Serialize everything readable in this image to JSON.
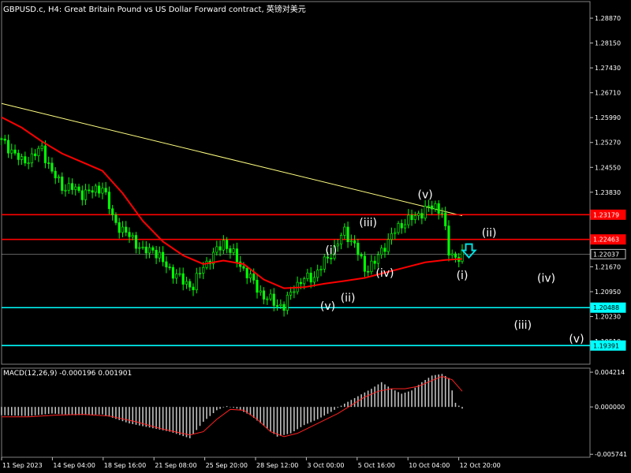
{
  "title": "GBPUSD.c, H4:  Great Britain Pound vs US Dollar Forward contract, 英镑对美元",
  "macd_label": "MACD(12,26,9) -0.000196 0.001901",
  "colors": {
    "background": "#000000",
    "grid": "#2f4f4f",
    "candle": "#00ff00",
    "ma": "#ff0000",
    "trendline": "#ffff80",
    "resistance": "#ff0000",
    "support": "#00ffff",
    "current_price": "#c0c0c0",
    "arrow": "#00e0e0",
    "histogram": "#c0c0c0",
    "signal": "#ff2020",
    "text": "#ffffff"
  },
  "chart_data": [
    {
      "type": "candlestick",
      "symbol": "GBPUSD.c",
      "timeframe": "H4",
      "ylim": [
        1.1885,
        1.2935
      ],
      "y_ticks": [
        "1.28870",
        "1.28150",
        "1.27430",
        "1.26710",
        "1.25990",
        "1.25270",
        "1.24550",
        "1.23830",
        "1.23110",
        "1.22390",
        "1.21670",
        "1.20950",
        "1.20230",
        "1.19510"
      ],
      "x_ticks": [
        "11 Sep 2023",
        "14 Sep 04:00",
        "18 Sep 16:00",
        "21 Sep 08:00",
        "25 Sep 20:00",
        "28 Sep 12:00",
        "3 Oct 00:00",
        "5 Oct 16:00",
        "10 Oct 04:00",
        "12 Oct 20:00"
      ],
      "close_path": [
        [
          0,
          1.253
        ],
        [
          3,
          1.2505
        ],
        [
          6,
          1.247
        ],
        [
          9,
          1.2485
        ],
        [
          12,
          1.251
        ],
        [
          15,
          1.244
        ],
        [
          18,
          1.24
        ],
        [
          21,
          1.2395
        ],
        [
          24,
          1.238
        ],
        [
          27,
          1.2385
        ],
        [
          30,
          1.24
        ],
        [
          33,
          1.231
        ],
        [
          36,
          1.227
        ],
        [
          39,
          1.225
        ],
        [
          42,
          1.221
        ],
        [
          45,
          1.222
        ],
        [
          48,
          1.218
        ],
        [
          51,
          1.215
        ],
        [
          54,
          1.2125
        ],
        [
          57,
          1.211
        ],
        [
          60,
          1.217
        ],
        [
          63,
          1.22
        ],
        [
          66,
          1.224
        ],
        [
          69,
          1.22
        ],
        [
          72,
          1.216
        ],
        [
          75,
          1.212
        ],
        [
          78,
          1.208
        ],
        [
          81,
          1.2065
        ],
        [
          84,
          1.205
        ],
        [
          87,
          1.211
        ],
        [
          90,
          1.213
        ],
        [
          93,
          1.214
        ],
        [
          96,
          1.218
        ],
        [
          99,
          1.222
        ],
        [
          102,
          1.227
        ],
        [
          105,
          1.223
        ],
        [
          108,
          1.216
        ],
        [
          111,
          1.218
        ],
        [
          114,
          1.223
        ],
        [
          117,
          1.227
        ],
        [
          120,
          1.23
        ],
        [
          123,
          1.231
        ],
        [
          126,
          1.2335
        ],
        [
          129,
          1.234
        ],
        [
          131,
          1.233
        ],
        [
          132,
          1.227
        ],
        [
          133,
          1.2205
        ],
        [
          135,
          1.2195
        ],
        [
          137,
          1.2204
        ]
      ],
      "series": [
        {
          "name": "MA",
          "values": [
            [
              0,
              1.26
            ],
            [
              6,
              1.257
            ],
            [
              12,
              1.253
            ],
            [
              18,
              1.2495
            ],
            [
              24,
              1.247
            ],
            [
              30,
              1.2445
            ],
            [
              36,
              1.238
            ],
            [
              42,
              1.23
            ],
            [
              48,
              1.224
            ],
            [
              54,
              1.22
            ],
            [
              60,
              1.2175
            ],
            [
              66,
              1.2185
            ],
            [
              72,
              1.2175
            ],
            [
              78,
              1.213
            ],
            [
              84,
              1.2105
            ],
            [
              90,
              1.2108
            ],
            [
              96,
              1.2118
            ],
            [
              102,
              1.2126
            ],
            [
              108,
              1.2135
            ],
            [
              114,
              1.215
            ],
            [
              120,
              1.2165
            ],
            [
              126,
              1.218
            ],
            [
              132,
              1.2187
            ],
            [
              137,
              1.219
            ]
          ]
        },
        {
          "name": "Trendline",
          "values": [
            [
              0,
              1.264
            ],
            [
              137,
              1.2315
            ]
          ]
        }
      ],
      "horizontal_lines": [
        {
          "price": 1.23179,
          "label": "1.23179",
          "kind": "resistance"
        },
        {
          "price": 1.22463,
          "label": "1.22463",
          "kind": "resistance"
        },
        {
          "price": 1.22037,
          "label": "1.22037",
          "kind": "current"
        },
        {
          "price": 1.20488,
          "label": "1.20488",
          "kind": "support"
        },
        {
          "price": 1.19391,
          "label": "1.19391",
          "kind": "support"
        }
      ],
      "wave_labels": [
        {
          "text": "(v)",
          "x": 126,
          "price": 1.2366
        },
        {
          "text": "(iii)",
          "x": 109,
          "price": 1.2285
        },
        {
          "text": "(i)",
          "x": 98,
          "price": 1.2205
        },
        {
          "text": "(iv)",
          "x": 114,
          "price": 1.2138
        },
        {
          "text": "(ii)",
          "x": 103,
          "price": 1.2067
        },
        {
          "text": "(v)",
          "x": 97,
          "price": 1.2042
        },
        {
          "text": "(ii)",
          "x": 145,
          "price": 1.2255
        },
        {
          "text": "(i)",
          "x": 137,
          "price": 1.2132
        },
        {
          "text": "(iv)",
          "x": 162,
          "price": 1.2124
        },
        {
          "text": "(iii)",
          "x": 155,
          "price": 1.1988
        },
        {
          "text": "(v)",
          "x": 171,
          "price": 1.1948
        }
      ],
      "arrow": {
        "direction": "down",
        "x": 139,
        "price": 1.221
      }
    },
    {
      "type": "bar",
      "name": "MACD(12,26,9)",
      "ylim": [
        -0.0061,
        0.0047
      ],
      "y_ticks": [
        "0.004214",
        "0.000000",
        "-0.005741"
      ],
      "histogram_path": [
        [
          0,
          -0.001
        ],
        [
          8,
          -0.0011
        ],
        [
          15,
          -0.0008
        ],
        [
          22,
          -0.001
        ],
        [
          30,
          -0.0009
        ],
        [
          38,
          -0.002
        ],
        [
          44,
          -0.0025
        ],
        [
          50,
          -0.003
        ],
        [
          56,
          -0.0038
        ],
        [
          60,
          -0.0018
        ],
        [
          64,
          -0.0004
        ],
        [
          67,
          0.0001
        ],
        [
          70,
          -0.0002
        ],
        [
          74,
          -0.001
        ],
        [
          78,
          -0.0023
        ],
        [
          82,
          -0.0036
        ],
        [
          86,
          -0.0032
        ],
        [
          90,
          -0.0022
        ],
        [
          94,
          -0.0015
        ],
        [
          98,
          -0.0006
        ],
        [
          102,
          0.0004
        ],
        [
          106,
          0.0013
        ],
        [
          110,
          0.0022
        ],
        [
          113,
          0.003
        ],
        [
          116,
          0.0022
        ],
        [
          119,
          0.0016
        ],
        [
          122,
          0.002
        ],
        [
          125,
          0.003
        ],
        [
          128,
          0.0038
        ],
        [
          131,
          0.004
        ],
        [
          133,
          0.0035
        ],
        [
          135,
          0.0005
        ],
        [
          137,
          -0.0002
        ]
      ],
      "series": [
        {
          "name": "Signal",
          "values": [
            [
              0,
              -0.0012
            ],
            [
              8,
              -0.0012
            ],
            [
              16,
              -0.001
            ],
            [
              24,
              -0.0009
            ],
            [
              32,
              -0.0011
            ],
            [
              40,
              -0.0018
            ],
            [
              48,
              -0.0027
            ],
            [
              56,
              -0.0034
            ],
            [
              60,
              -0.003
            ],
            [
              64,
              -0.0015
            ],
            [
              68,
              -0.0003
            ],
            [
              72,
              -0.0004
            ],
            [
              76,
              -0.0015
            ],
            [
              80,
              -0.003
            ],
            [
              84,
              -0.0036
            ],
            [
              88,
              -0.0032
            ],
            [
              92,
              -0.0024
            ],
            [
              96,
              -0.0016
            ],
            [
              100,
              -0.0008
            ],
            [
              104,
              0.0002
            ],
            [
              108,
              0.0012
            ],
            [
              112,
              0.0019
            ],
            [
              116,
              0.0022
            ],
            [
              120,
              0.0022
            ],
            [
              124,
              0.0025
            ],
            [
              128,
              0.0032
            ],
            [
              131,
              0.0037
            ],
            [
              134,
              0.0033
            ],
            [
              137,
              0.0019
            ]
          ]
        }
      ]
    }
  ]
}
